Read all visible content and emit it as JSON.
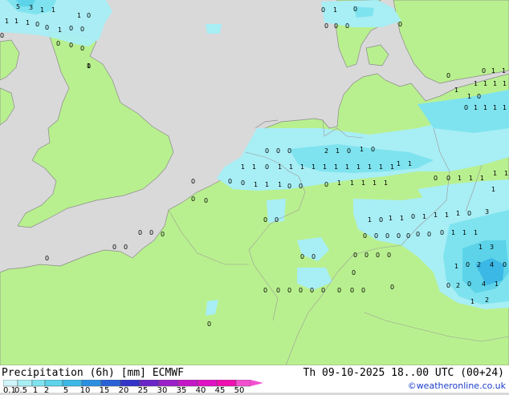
{
  "legend": {
    "title": "Precipitation (6h) [mm] ECMWF",
    "valid_time": "Th 09-10-2025 18..00 UTC (00+24)",
    "credit": "©weatheronline.co.uk",
    "scale_labels": [
      "0.1",
      "0.5",
      "1",
      "2",
      "5",
      "10",
      "15",
      "20",
      "25",
      "30",
      "35",
      "40",
      "45",
      "50"
    ],
    "scale_colors": [
      "#cff5f9",
      "#a8eef5",
      "#7ee3ef",
      "#5cd3e9",
      "#3cb8e6",
      "#2a8fe0",
      "#2a62d6",
      "#3534c8",
      "#6a26c6",
      "#9a1ec9",
      "#c417c8",
      "#e012c3",
      "#f00fb0",
      "#f44fd0"
    ]
  },
  "colors": {
    "land": "#b9f08f",
    "sea": "#d9d9d9",
    "border": "#9a9a9a",
    "coast": "#8a8a8a"
  },
  "precip_labels": [
    {
      "t": "5"
    },
    {
      "t": "3"
    },
    {
      "t": "1"
    },
    {
      "t": "1"
    },
    {
      "t": "1"
    },
    {
      "t": "0"
    },
    {
      "t": "1"
    },
    {
      "t": "1"
    },
    {
      "t": "1"
    },
    {
      "t": "0"
    },
    {
      "t": "0"
    },
    {
      "t": "1"
    },
    {
      "t": "0"
    },
    {
      "t": "0"
    },
    {
      "t": "0"
    },
    {
      "t": "0"
    },
    {
      "t": "0"
    },
    {
      "t": "0"
    },
    {
      "t": "0"
    },
    {
      "t": "0"
    },
    {
      "t": "1"
    },
    {
      "t": "0"
    },
    {
      "t": "0"
    },
    {
      "t": "0"
    },
    {
      "t": "0"
    },
    {
      "t": "0"
    },
    {
      "t": "0"
    },
    {
      "t": "1"
    },
    {
      "t": "1"
    },
    {
      "t": "1"
    },
    {
      "t": "1"
    },
    {
      "t": "1"
    },
    {
      "t": "1"
    },
    {
      "t": "1"
    },
    {
      "t": "0"
    },
    {
      "t": "0"
    },
    {
      "t": "1"
    },
    {
      "t": "0"
    },
    {
      "t": "1"
    },
    {
      "t": "1"
    },
    {
      "t": "1"
    },
    {
      "t": "1"
    },
    {
      "t": "0"
    },
    {
      "t": "0"
    },
    {
      "t": "0"
    },
    {
      "t": "2"
    },
    {
      "t": "1"
    },
    {
      "t": "0"
    },
    {
      "t": "1"
    },
    {
      "t": "0"
    },
    {
      "t": "1"
    },
    {
      "t": "1"
    },
    {
      "t": "0"
    },
    {
      "t": "1"
    },
    {
      "t": "1"
    },
    {
      "t": "1"
    },
    {
      "t": "1"
    },
    {
      "t": "1"
    },
    {
      "t": "1"
    },
    {
      "t": "1"
    },
    {
      "t": "1"
    },
    {
      "t": "1"
    },
    {
      "t": "1"
    },
    {
      "t": "1"
    },
    {
      "t": "1"
    },
    {
      "t": "1"
    },
    {
      "t": "0"
    },
    {
      "t": "0"
    },
    {
      "t": "0"
    },
    {
      "t": "1"
    },
    {
      "t": "1"
    },
    {
      "t": "1"
    },
    {
      "t": "0"
    },
    {
      "t": "0"
    },
    {
      "t": "0"
    },
    {
      "t": "1"
    },
    {
      "t": "1"
    },
    {
      "t": "1"
    },
    {
      "t": "1"
    },
    {
      "t": "1"
    },
    {
      "t": "0"
    },
    {
      "t": "0"
    },
    {
      "t": "1"
    },
    {
      "t": "1"
    },
    {
      "t": "1"
    },
    {
      "t": "1"
    },
    {
      "t": "1"
    },
    {
      "t": "1"
    },
    {
      "t": "1"
    },
    {
      "t": "0"
    },
    {
      "t": "1"
    },
    {
      "t": "1"
    },
    {
      "t": "0"
    },
    {
      "t": "1"
    },
    {
      "t": "1"
    },
    {
      "t": "1"
    },
    {
      "t": "1"
    },
    {
      "t": "0"
    },
    {
      "t": "3"
    },
    {
      "t": "0"
    },
    {
      "t": "0"
    },
    {
      "t": "0"
    },
    {
      "t": "0"
    },
    {
      "t": "0"
    },
    {
      "t": "0"
    },
    {
      "t": "0"
    },
    {
      "t": "0"
    },
    {
      "t": "1"
    },
    {
      "t": "1"
    },
    {
      "t": "1"
    },
    {
      "t": "0"
    },
    {
      "t": "0"
    },
    {
      "t": "0"
    },
    {
      "t": "0"
    },
    {
      "t": "1"
    },
    {
      "t": "3"
    },
    {
      "t": "1"
    },
    {
      "t": "0"
    },
    {
      "t": "2"
    },
    {
      "t": "4"
    },
    {
      "t": "0"
    },
    {
      "t": "0"
    },
    {
      "t": "2"
    },
    {
      "t": "0"
    },
    {
      "t": "4"
    },
    {
      "t": "1"
    },
    {
      "t": "1"
    },
    {
      "t": "2"
    },
    {
      "t": "0"
    },
    {
      "t": "0"
    },
    {
      "t": "0"
    },
    {
      "t": "0"
    },
    {
      "t": "0"
    },
    {
      "t": "0"
    },
    {
      "t": "0"
    },
    {
      "t": "0"
    },
    {
      "t": "0"
    },
    {
      "t": "0"
    },
    {
      "t": "0"
    },
    {
      "t": "0"
    },
    {
      "t": "0"
    },
    {
      "t": "0"
    },
    {
      "t": "0"
    },
    {
      "t": "0"
    },
    {
      "t": "0"
    },
    {
      "t": "0"
    },
    {
      "t": "0"
    },
    {
      "t": "0"
    },
    {
      "t": "0"
    },
    {
      "t": "0"
    },
    {
      "t": "0"
    },
    {
      "t": "0"
    },
    {
      "t": "1"
    }
  ]
}
